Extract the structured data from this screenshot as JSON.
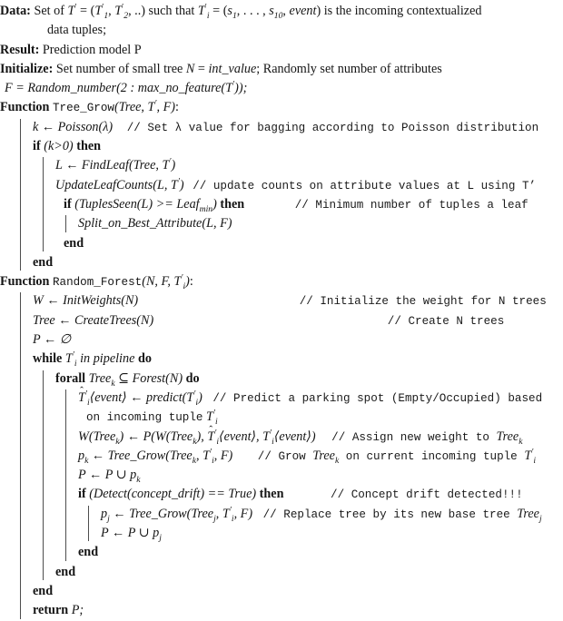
{
  "document": {
    "kind": "algorithm-pseudocode",
    "background_color": "#ffffff",
    "text_color": "#151515",
    "rule_color": "#4d4d4d"
  },
  "preamble": {
    "data_label": "Data:",
    "data_text_1": "Set of T′ = (T′1, T′2, ..) such that T′i = (s1, . . . , s10, event) is the incoming contextualized",
    "data_text_2": "data tuples;",
    "result_label": "Result:",
    "result_text": "Prediction model P",
    "initialize_label": "Initialize:",
    "initialize_text": "Set number of small tree N = int_value; Randomly set number of attributes",
    "initialize_text_2": "F = Random_number(2 : max_no_feature(T′));"
  },
  "tree_grow": {
    "function_keyword": "Function",
    "signature": "Tree_Grow(Tree, T′, F):",
    "line_poisson": "k ← Poisson(λ)",
    "comment_poisson": "// Set λ value for bagging according to Poisson distribution",
    "if_keyword": "if",
    "if_condition": "(k>0)",
    "then_keyword": "then",
    "line_findleaf": "L ← FindLeaf(Tree, T′)",
    "line_updatecounts": "UpdateLeafCounts(L, T′)",
    "comment_updatecounts": "// update counts on attribute values at L using T'",
    "if2_keyword": "if",
    "if2_condition": "(TuplesSeen(L) >= Leafmin)",
    "then2_keyword": "then",
    "comment_if2": "// Minimum number of tuples a leaf",
    "line_split": "Split_on_Best_Attribute(L, F)",
    "end_inner": "end",
    "end_outer": "end"
  },
  "random_forest": {
    "function_keyword": "Function",
    "signature": "Random_Forest(N, F, T′i):",
    "line_initweights": "W ← InitWeights(N)",
    "comment_initweights": "// Initialize the weight for N trees",
    "line_createtrees": "Tree ← CreateTrees(N)",
    "comment_createtrees": "// Create N trees",
    "line_p_empty": "P ← ∅",
    "while_keyword": "while",
    "while_condition": "T′i in pipeline",
    "do_keyword": "do",
    "forall_keyword": "forall",
    "forall_condition": "Treek ⊆ Forest(N)",
    "do2_keyword": "do",
    "line_predict": "T̂′i⟨event⟩ ← predict(T′i)",
    "comment_predict": "// Predict a parking spot (Empty/Occupied) based",
    "comment_predict_cont": "on incoming tuple T′i",
    "line_weight": "W(Treek) ← P(W(Treek), T̂′i⟨event⟩, T′i⟨event⟩)",
    "comment_weight": "// Assign new weight to Treek",
    "line_grow": "pk ← Tree_Grow(Treek, T′i, F)",
    "comment_grow": "// Grow Treek on current incoming tuple T′i",
    "line_union_pk": "P ← P ∪ pk",
    "if_keyword": "if",
    "if_condition": "(Detect(concept_drift) == True)",
    "then_keyword": "then",
    "comment_drift": "// Concept drift detected!!!",
    "line_replace": "pj ← Tree_Grow(Treej, T′i, F)",
    "comment_replace": "// Replace tree by its new base tree Treej",
    "line_union_pj": "P ← P ∪ pj",
    "end_if": "end",
    "end_forall": "end",
    "end_while": "end",
    "return_keyword": "return",
    "return_value": "P;"
  }
}
